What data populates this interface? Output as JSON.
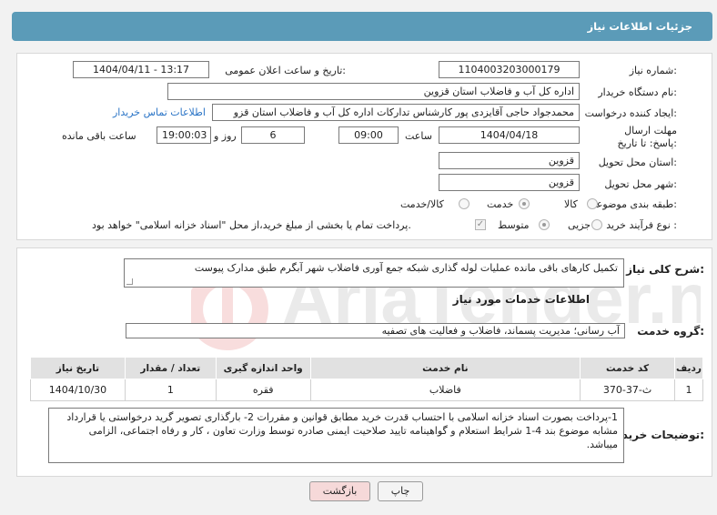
{
  "header": {
    "title": "جزئیات اطلاعات نیاز"
  },
  "form": {
    "need_number_label": "شماره نیاز:",
    "need_number": "1104003203000179",
    "announce_label": "تاریخ و ساعت اعلان عمومی:",
    "announce_value": "1404/04/11 - 13:17",
    "buyer_org_label": "نام دستگاه خریدار:",
    "buyer_org": "اداره کل آب و فاضلاب استان قزوین",
    "creator_label": "ایجاد کننده درخواست:",
    "creator": "محمدجواد حاجی آقایزدی پور کارشناس تدارکات اداره کل آب و فاضلاب استان قزو",
    "contact_link": "اطلاعات تماس خریدار",
    "deadline_label": "مهلت ارسال پاسخ: تا تاریخ:",
    "deadline_date": "1404/04/18",
    "time_label": "ساعت",
    "deadline_time": "09:00",
    "days_value": "6",
    "days_label": "روز و",
    "remaining_time": "19:00:03",
    "remaining_label": "ساعت باقی مانده",
    "province_label": "استان محل تحویل:",
    "province": "قزوین",
    "city_label": "شهر محل تحویل:",
    "city": "قزوین",
    "category_label": "طبقه بندی موضوعی:",
    "category_options": [
      "کالا",
      "خدمت",
      "کالا/خدمت"
    ],
    "category_selected": "خدمت",
    "process_label": "نوع فرآیند خرید :",
    "process_options": [
      "جزیی",
      "متوسط"
    ],
    "process_selected": "متوسط",
    "payment_note": "پرداخت تمام یا بخشی از مبلغ خرید،از محل \"اسناد خزانه اسلامی\" خواهد بود."
  },
  "summary": {
    "label": "شرح کلی نیاز:",
    "text": "تکمیل کارهای باقی مانده عملیات لوله گذاری شبکه جمع آوری فاضلاب شهر آبگرم طبق مدارک پیوست"
  },
  "services": {
    "section_title": "اطلاعات خدمات مورد نیاز",
    "group_label": "گروه خدمت:",
    "group_value": "آب رسانی؛ مدیریت پسماند، فاضلاب و فعالیت های تصفیه",
    "columns": [
      "ردیف",
      "کد خدمت",
      "نام خدمت",
      "واحد اندازه گیری",
      "تعداد / مقدار",
      "تاریخ نیاز"
    ],
    "rows": [
      {
        "row": "1",
        "code": "ث-37-370",
        "name": "فاضلاب",
        "unit": "فقره",
        "qty": "1",
        "date": "1404/10/30"
      }
    ]
  },
  "buyer_notes": {
    "label": "توضیحات خریدار:",
    "text": "1-پرداخت بصورت اسناد خزانه اسلامی با احتساب قدرت خرید مطابق قوانین و مقررات 2- بارگذاری تصویر گرید درخواستی یا قرارداد مشابه موضوع بند 4-1 شرایط استعلام و گواهینامه تایید صلاحیت ایمنی صادره توسط وزارت تعاون ، کار و رفاه اجتماعی، الزامی میباشد."
  },
  "buttons": {
    "print": "چاپ",
    "back": "بازگشت"
  },
  "watermark": "AriaTender.net",
  "colors": {
    "header": "#5b9bb8",
    "back_button": "#f6d9d9",
    "link": "#2a74c6"
  }
}
